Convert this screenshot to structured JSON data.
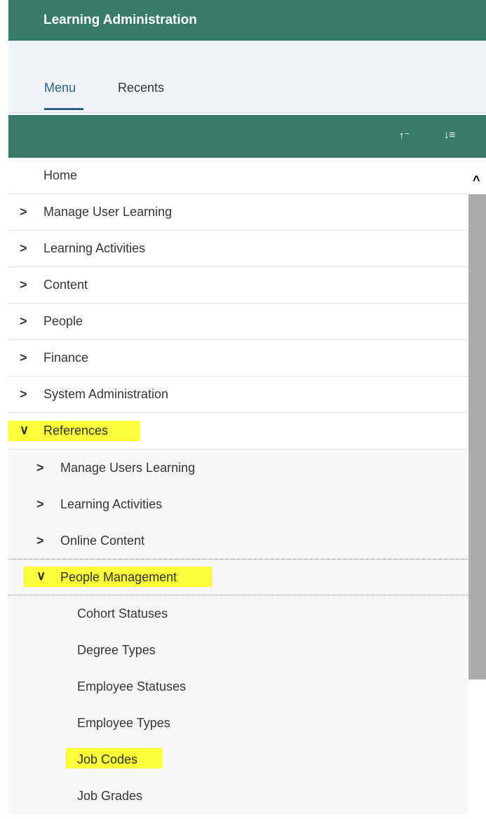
{
  "header": {
    "title": "Learning Administration"
  },
  "tabs": [
    {
      "label": "Menu",
      "active": true
    },
    {
      "label": "Recents",
      "active": false
    }
  ],
  "toolbar": {
    "sort_asc_icon": "↑⁻",
    "sort_desc_icon": "↓≡"
  },
  "menu": {
    "home": "Home",
    "top_items": [
      {
        "label": "Manage User Learning",
        "expanded": false
      },
      {
        "label": "Learning Activities",
        "expanded": false
      },
      {
        "label": "Content",
        "expanded": false
      },
      {
        "label": "People",
        "expanded": false
      },
      {
        "label": "Finance",
        "expanded": false
      },
      {
        "label": "System Administration",
        "expanded": false
      },
      {
        "label": "References",
        "expanded": true,
        "highlighted": true
      }
    ],
    "reference_items": [
      {
        "label": "Manage Users Learning",
        "expanded": false
      },
      {
        "label": "Learning Activities",
        "expanded": false
      },
      {
        "label": "Online Content",
        "expanded": false
      },
      {
        "label": "People Management",
        "expanded": true,
        "highlighted": true
      }
    ],
    "people_management_items": [
      {
        "label": "Cohort Statuses"
      },
      {
        "label": "Degree Types"
      },
      {
        "label": "Employee Statuses"
      },
      {
        "label": "Employee Types"
      },
      {
        "label": "Job Codes",
        "highlighted": true
      },
      {
        "label": "Job Grades"
      }
    ]
  },
  "icons": {
    "chevron_right": "›",
    "chevron_down": "⌄",
    "scroll_up": "^"
  },
  "colors": {
    "header_bg": "#3a7a6a",
    "tab_active": "#2b5f8a",
    "highlight": "#fbff3a"
  }
}
